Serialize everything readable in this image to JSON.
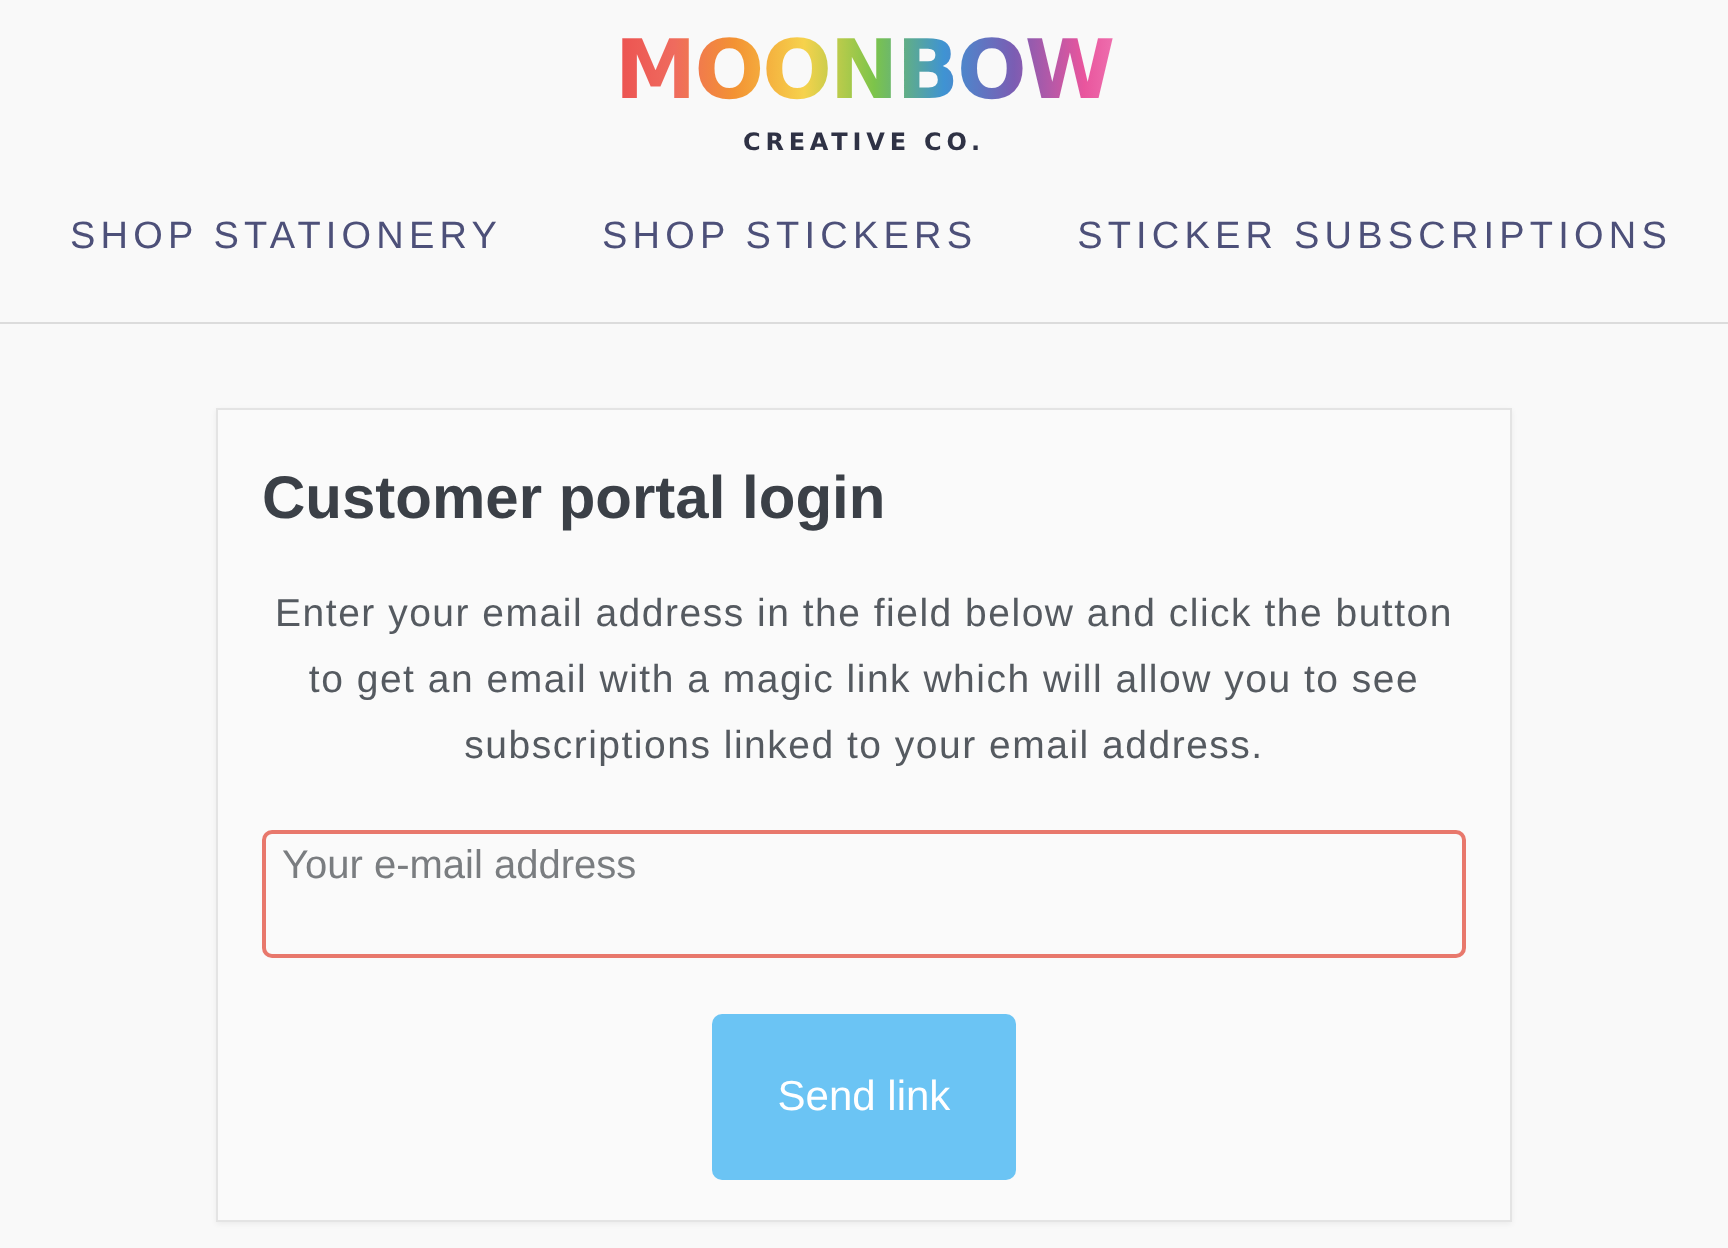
{
  "header": {
    "logo": {
      "wordmark": "MOONBOW",
      "tagline": "CREATIVE CO."
    },
    "nav": [
      "SHOP STATIONERY",
      "SHOP STICKERS",
      "STICKER SUBSCRIPTIONS"
    ]
  },
  "login_card": {
    "title": "Customer portal login",
    "description": "Enter your email address in the field below and click the button to get an email with a magic link which will allow you to see subscriptions linked to your email address.",
    "email_field": {
      "placeholder": "Your e-mail address",
      "invalid": true
    },
    "button": {
      "label": "Send link"
    }
  }
}
